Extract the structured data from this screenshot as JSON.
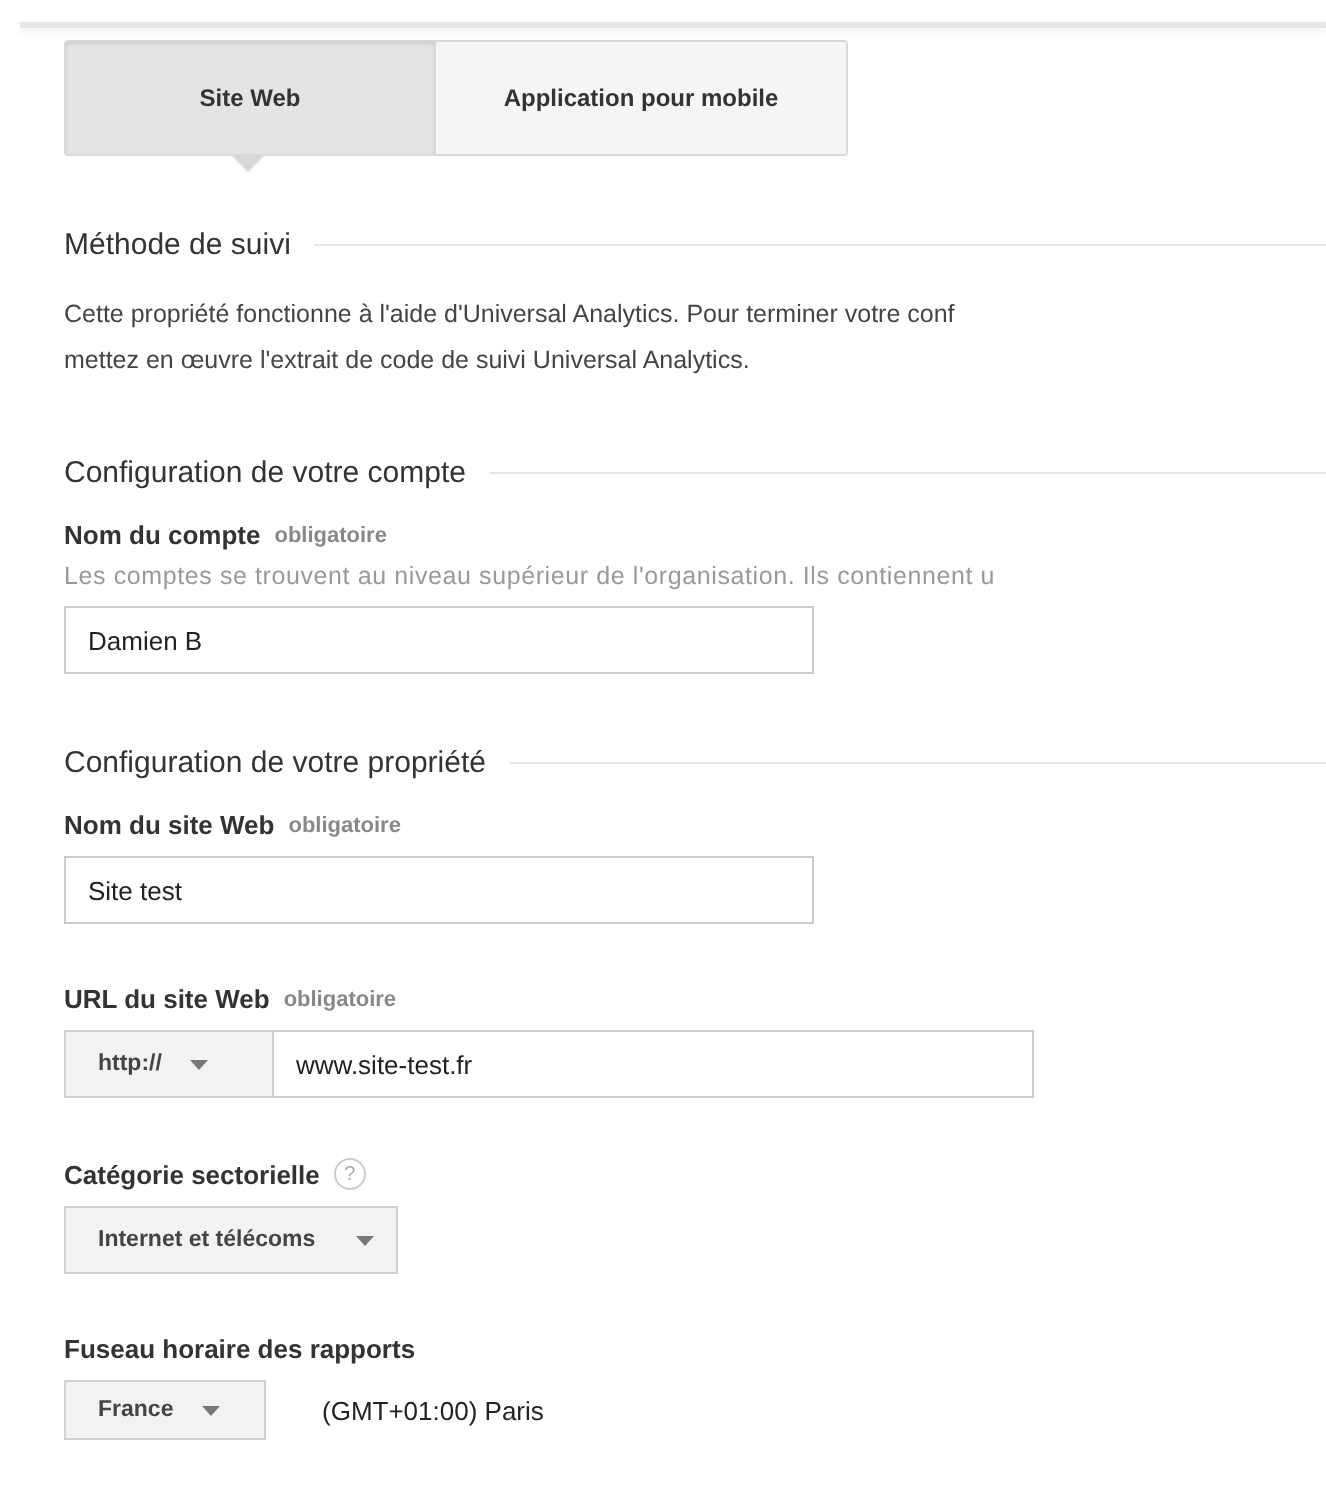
{
  "tabs": [
    {
      "label": "Site Web",
      "selected": true
    },
    {
      "label": "Application pour mobile",
      "selected": false
    }
  ],
  "sections": [
    {
      "title": "Méthode de suivi",
      "paragraphs": [
        "Cette propriété fonctionne à l'aide d'Universal Analytics. Pour terminer votre conf",
        "mettez en œuvre l'extrait de code de suivi Universal Analytics."
      ]
    },
    {
      "title": "Configuration de votre compte",
      "fields": [
        {
          "kind": "text",
          "label": "Nom du compte",
          "required": "obligatoire",
          "description": "Les comptes se trouvent au niveau supérieur de l'organisation. Ils contiennent u",
          "value": "Damien B"
        }
      ]
    },
    {
      "title": "Configuration de votre propriété",
      "fields": [
        {
          "kind": "text",
          "label": "Nom du site Web",
          "required": "obligatoire",
          "value": "Site test"
        },
        {
          "kind": "url",
          "label": "URL du site Web",
          "required": "obligatoire",
          "protocol": "http://",
          "value": "www.site-test.fr"
        },
        {
          "kind": "select",
          "label": "Catégorie sectorielle",
          "help": "?",
          "value": "Internet et télécoms"
        },
        {
          "kind": "timezone",
          "label": "Fuseau horaire des rapports",
          "country": "France",
          "zone": "(GMT+01:00) Paris"
        }
      ]
    }
  ]
}
